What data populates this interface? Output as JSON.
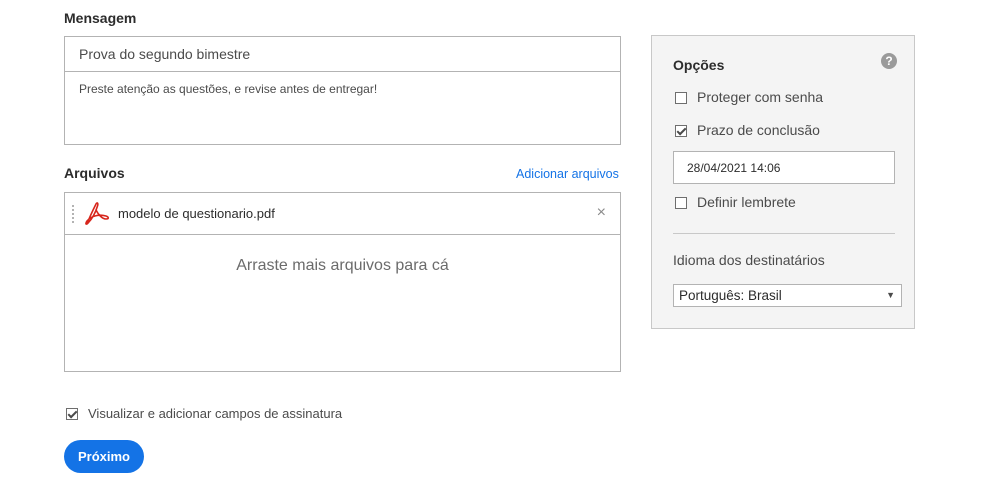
{
  "message": {
    "section_label": "Mensagem",
    "subject": "Prova do segundo bimestre",
    "body": "Preste atenção as questões, e revise antes de entregar!"
  },
  "files": {
    "section_label": "Arquivos",
    "add_link": "Adicionar arquivos",
    "items": [
      {
        "name": "modelo de questionario.pdf",
        "icon": "pdf-icon"
      }
    ],
    "remove_symbol": "×",
    "drop_hint": "Arraste mais arquivos para cá"
  },
  "signature_fields": {
    "label": "Visualizar e adicionar campos de assinatura",
    "checked": true
  },
  "next_button": "Próximo",
  "options": {
    "title": "Opções",
    "help_symbol": "?",
    "password": {
      "label": "Proteger com senha",
      "checked": false
    },
    "deadline": {
      "label": "Prazo de conclusão",
      "checked": true,
      "value": "28/04/2021 14:06"
    },
    "reminder": {
      "label": "Definir lembrete",
      "checked": false
    },
    "language": {
      "label": "Idioma dos destinatários",
      "selected": "Português: Brasil",
      "arrow": "▼"
    }
  },
  "colors": {
    "accent": "#1473e6",
    "pdf_red": "#d7261c",
    "panel_bg": "#f4f4f4"
  }
}
